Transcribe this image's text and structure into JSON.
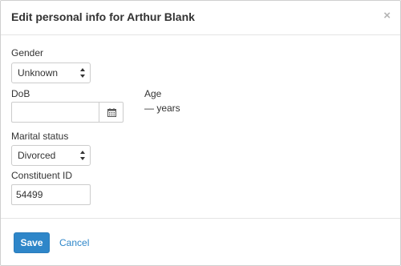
{
  "dialog": {
    "title": "Edit personal info for Arthur Blank",
    "close_label": "×"
  },
  "form": {
    "gender": {
      "label": "Gender",
      "value": "Unknown"
    },
    "dob": {
      "label": "DoB",
      "value": ""
    },
    "age": {
      "label": "Age",
      "value": "— years"
    },
    "marital_status": {
      "label": "Marital status",
      "value": "Divorced"
    },
    "constituent_id": {
      "label": "Constituent ID",
      "value": "54499"
    }
  },
  "footer": {
    "save_label": "Save",
    "cancel_label": "Cancel"
  },
  "colors": {
    "primary": "#2e86c9",
    "border": "#cccccc",
    "divider": "#e5e5e5"
  },
  "icons": {
    "calendar": "calendar-icon",
    "select_arrows": "sort-arrows-icon",
    "close": "close-icon"
  }
}
